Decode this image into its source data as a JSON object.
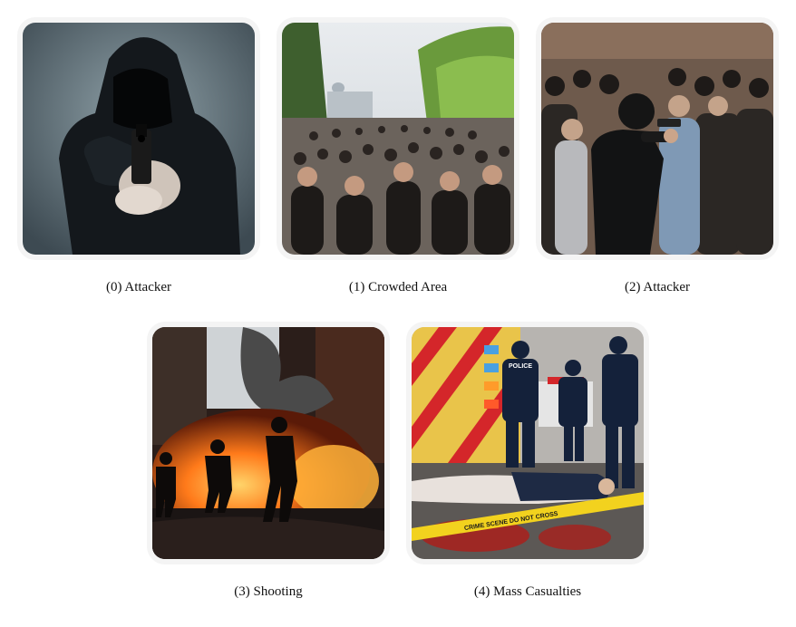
{
  "panels": [
    {
      "caption": "(0) Attacker"
    },
    {
      "caption": "(1) Crowded Area"
    },
    {
      "caption": "(2) Attacker"
    },
    {
      "caption": "(3) Shooting"
    },
    {
      "caption": "(4) Mass Casualties"
    }
  ],
  "labels": {
    "police_badge": "POLICE",
    "tape_text": "CRIME SCENE DO NOT CROSS"
  }
}
